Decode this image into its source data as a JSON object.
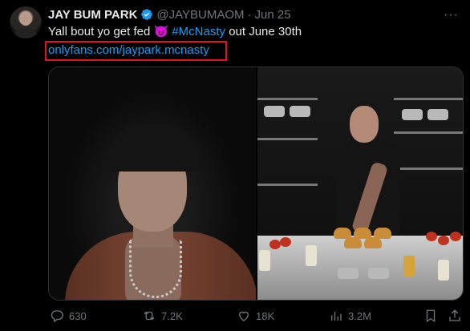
{
  "tweet": {
    "author_name": "JAY BUM PARK",
    "handle": "@JAYBUMAOM",
    "separator": "·",
    "date": "Jun 25",
    "text_before": "Yall bout yo get fed ",
    "emoji": "😈",
    "hashtag": "#McNasty",
    "text_after": " out June 30th",
    "link": "onlyfans.com/jaypark.mcnasty",
    "more_label": "···"
  },
  "actions": {
    "replies": "630",
    "reposts": "7.2K",
    "likes": "18K",
    "views": "3.2M"
  },
  "colors": {
    "accent": "#1d9bf0",
    "highlight_box": "#e0151b",
    "muted": "#71767b",
    "background": "#000000"
  },
  "icons": [
    "verified-badge-icon",
    "more-icon",
    "reply-icon",
    "repost-icon",
    "like-icon",
    "views-icon",
    "bookmark-icon",
    "share-icon"
  ]
}
